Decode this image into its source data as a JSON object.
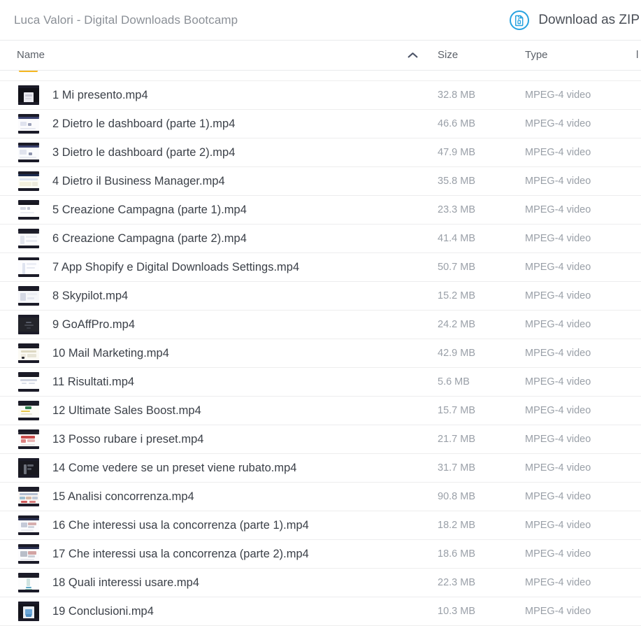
{
  "header": {
    "folder_title": "Luca Valori - Digital Downloads Bootcamp",
    "download_zip_label": "Download as ZIP",
    "download_zip_icon": "zip-file-circle-icon",
    "accent_color": "#29a3e0"
  },
  "columns": {
    "name": "Name",
    "size": "Size",
    "type": "Type",
    "extra_cut_off": "l",
    "sort_icon": "chevron-up-icon",
    "sort_direction": "ascending",
    "sorted_by": "Name"
  },
  "files": [
    {
      "name": "1 Mi presento.mp4",
      "size": "32.8 MB",
      "type": "MPEG-4 video",
      "thumb": {
        "bg": "#111118",
        "flecks": [
          [
            8,
            6,
            14,
            16,
            "#e9e9ef"
          ],
          [
            10,
            9,
            10,
            3,
            "#c9c9d6"
          ],
          [
            10,
            14,
            9,
            2,
            "#d6d6e0"
          ]
        ]
      }
    },
    {
      "name": "2 Dietro le dashboard (parte 1).mp4",
      "size": "46.6 MB",
      "type": "MPEG-4 video",
      "thumb": {
        "bg": "#fbfbfd",
        "flecks": [
          [
            0,
            0,
            30,
            3,
            "#3c4370"
          ],
          [
            3,
            7,
            9,
            6,
            "#dfe2ee"
          ],
          [
            14,
            9,
            5,
            4,
            "#9aa0b8"
          ],
          [
            3,
            16,
            22,
            2,
            "#e6e8f0"
          ]
        ]
      }
    },
    {
      "name": "3 Dietro le dashboard (parte 2).mp4",
      "size": "47.9 MB",
      "type": "MPEG-4 video",
      "thumb": {
        "bg": "#fafbfd",
        "flecks": [
          [
            0,
            0,
            30,
            3,
            "#3c4370"
          ],
          [
            2,
            6,
            10,
            7,
            "#e1e4ee"
          ],
          [
            15,
            10,
            5,
            4,
            "#8d93ad"
          ],
          [
            2,
            16,
            24,
            2,
            "#e8eaf1"
          ]
        ]
      }
    },
    {
      "name": "4 Dietro il Business Manager.mp4",
      "size": "35.8 MB",
      "type": "MPEG-4 video",
      "thumb": {
        "bg": "#fdfdf6",
        "flecks": [
          [
            0,
            0,
            30,
            3,
            "#1b2a4e"
          ],
          [
            2,
            6,
            26,
            3,
            "#dfe6f2"
          ],
          [
            2,
            11,
            17,
            6,
            "#f3f0de"
          ],
          [
            20,
            11,
            8,
            6,
            "#eceadd"
          ]
        ]
      }
    },
    {
      "name": "5 Creazione Campagna (parte 1).mp4",
      "size": "23.3 MB",
      "type": "MPEG-4 video",
      "thumb": {
        "bg": "#ffffff",
        "flecks": [
          [
            0,
            0,
            30,
            3,
            "#16161e"
          ],
          [
            3,
            6,
            8,
            4,
            "#d7dae4"
          ],
          [
            13,
            6,
            4,
            4,
            "#c4c8d4"
          ],
          [
            3,
            13,
            20,
            2,
            "#eceef3"
          ]
        ]
      }
    },
    {
      "name": "6 Creazione Campagna (parte 2).mp4",
      "size": "41.4 MB",
      "type": "MPEG-4 video",
      "thumb": {
        "bg": "#fcfcfe",
        "flecks": [
          [
            0,
            0,
            30,
            3,
            "#21212c"
          ],
          [
            3,
            6,
            6,
            12,
            "#e2e5ee"
          ],
          [
            11,
            6,
            16,
            3,
            "#eef0f5"
          ],
          [
            11,
            12,
            16,
            3,
            "#e8eaf2"
          ]
        ]
      }
    },
    {
      "name": "7 App Shopify e Digital Downloads Settings.mp4",
      "size": "50.7 MB",
      "type": "MPEG-4 video",
      "thumb": {
        "bg": "#fdfdff",
        "flecks": [
          [
            6,
            4,
            4,
            16,
            "#dfe4f0"
          ],
          [
            12,
            4,
            14,
            3,
            "#eceef6"
          ],
          [
            12,
            10,
            12,
            2,
            "#e6e9f2"
          ]
        ]
      }
    },
    {
      "name": "8 Skypilot.mp4",
      "size": "15.2 MB",
      "type": "MPEG-4 video",
      "thumb": {
        "bg": "#f6f7fa",
        "flecks": [
          [
            0,
            0,
            30,
            3,
            "#1e1e28"
          ],
          [
            3,
            6,
            8,
            11,
            "#d4d8e4"
          ],
          [
            13,
            6,
            14,
            3,
            "#eceef4"
          ],
          [
            13,
            12,
            10,
            3,
            "#e4e7f0"
          ]
        ]
      }
    },
    {
      "name": "9 GoAffPro.mp4",
      "size": "24.2 MB",
      "type": "MPEG-4 video",
      "thumb": {
        "bg": "#23242a",
        "flecks": [
          [
            11,
            6,
            8,
            2,
            "#565a66"
          ],
          [
            9,
            10,
            13,
            2,
            "#44474f"
          ],
          [
            12,
            14,
            6,
            2,
            "#3a3d46"
          ]
        ]
      }
    },
    {
      "name": "10 Mail Marketing.mp4",
      "size": "42.9 MB",
      "type": "MPEG-4 video",
      "thumb": {
        "bg": "#fbfaf4",
        "flecks": [
          [
            0,
            0,
            30,
            3,
            "#1a1a24"
          ],
          [
            4,
            6,
            22,
            3,
            "#ded9c3"
          ],
          [
            4,
            11,
            7,
            6,
            "#f0ece0"
          ],
          [
            13,
            11,
            13,
            5,
            "#e7e4d6"
          ],
          [
            5,
            15,
            4,
            3,
            "#2b2b33"
          ]
        ]
      }
    },
    {
      "name": "11 Risultati.mp4",
      "size": "5.6 MB",
      "type": "MPEG-4 video",
      "thumb": {
        "bg": "#ffffff",
        "flecks": [
          [
            0,
            0,
            30,
            3,
            "#191923"
          ],
          [
            3,
            6,
            24,
            3,
            "#cfd4e0"
          ],
          [
            5,
            11,
            7,
            2,
            "#dadee8"
          ],
          [
            15,
            11,
            9,
            2,
            "#dadee8"
          ]
        ]
      }
    },
    {
      "name": "12 Ultimate Sales Boost.mp4",
      "size": "15.7 MB",
      "type": "MPEG-4 video",
      "thumb": {
        "bg": "#fdfcf7",
        "flecks": [
          [
            0,
            0,
            30,
            3,
            "#1c1c26"
          ],
          [
            10,
            4,
            9,
            4,
            "#2f7d4e"
          ],
          [
            4,
            10,
            13,
            2,
            "#e8c84a"
          ],
          [
            4,
            14,
            16,
            2,
            "#e6e3d6"
          ]
        ]
      }
    },
    {
      "name": "13 Posso rubare i preset.mp4",
      "size": "21.7 MB",
      "type": "MPEG-4 video",
      "thumb": {
        "bg": "#fdfbfb",
        "flecks": [
          [
            0,
            0,
            30,
            3,
            "#22222c"
          ],
          [
            4,
            5,
            20,
            4,
            "#c74b4b"
          ],
          [
            4,
            10,
            7,
            5,
            "#dd8383"
          ],
          [
            13,
            10,
            11,
            4,
            "#e8b4b4"
          ],
          [
            4,
            17,
            20,
            2,
            "#e9e6e6"
          ]
        ]
      }
    },
    {
      "name": "14 Come vedere se un preset viene rubato.mp4",
      "size": "31.7 MB",
      "type": "MPEG-4 video",
      "thumb": {
        "bg": "#191920",
        "flecks": [
          [
            8,
            5,
            4,
            14,
            "#6e727c"
          ],
          [
            13,
            5,
            9,
            3,
            "#5b5f69"
          ],
          [
            13,
            10,
            6,
            3,
            "#4c505a"
          ]
        ]
      }
    },
    {
      "name": "15 Analisi concorrenza.mp4",
      "size": "90.8 MB",
      "type": "MPEG-4 video",
      "thumb": {
        "bg": "#fbf7f4",
        "flecks": [
          [
            0,
            0,
            30,
            3,
            "#23232e"
          ],
          [
            2,
            5,
            26,
            3,
            "#b5c0d2"
          ],
          [
            2,
            10,
            8,
            4,
            "#9fbfd0"
          ],
          [
            11,
            10,
            8,
            4,
            "#d8b9a6"
          ],
          [
            20,
            10,
            8,
            4,
            "#c0cad8"
          ],
          [
            4,
            16,
            9,
            3,
            "#cf5a5a"
          ],
          [
            16,
            16,
            9,
            3,
            "#d77b7b"
          ]
        ]
      }
    },
    {
      "name": "16 Che interessi usa la concorrenza (parte 1).mp4",
      "size": "18.2 MB",
      "type": "MPEG-4 video",
      "thumb": {
        "bg": "#fcfcfe",
        "flecks": [
          [
            0,
            0,
            30,
            3,
            "#2a3050"
          ],
          [
            4,
            6,
            9,
            7,
            "#c5cad8"
          ],
          [
            14,
            6,
            12,
            4,
            "#d6aeae"
          ],
          [
            14,
            11,
            9,
            3,
            "#cfd4de"
          ],
          [
            4,
            16,
            18,
            2,
            "#e9ebf1"
          ]
        ]
      }
    },
    {
      "name": "17 Che interessi usa la concorrenza (parte 2).mp4",
      "size": "18.6 MB",
      "type": "MPEG-4 video",
      "thumb": {
        "bg": "#fbfbfd",
        "flecks": [
          [
            0,
            0,
            30,
            3,
            "#2a3050"
          ],
          [
            3,
            6,
            10,
            8,
            "#b9bec9"
          ],
          [
            14,
            6,
            12,
            5,
            "#d2a3a3"
          ],
          [
            14,
            12,
            10,
            3,
            "#c9ced8"
          ],
          [
            3,
            17,
            20,
            2,
            "#e7e9ef"
          ]
        ]
      }
    },
    {
      "name": "18 Quali interessi usare.mp4",
      "size": "22.3 MB",
      "type": "MPEG-4 video",
      "thumb": {
        "bg": "#fcfdfd",
        "flecks": [
          [
            0,
            0,
            30,
            3,
            "#1d1d27"
          ],
          [
            12,
            4,
            5,
            11,
            "#cfe3e0"
          ],
          [
            11,
            16,
            8,
            2,
            "#5ea7c8"
          ],
          [
            10,
            19,
            10,
            2,
            "#8fd0bb"
          ]
        ]
      }
    },
    {
      "name": "19 Conclusioni.mp4",
      "size": "10.3 MB",
      "type": "MPEG-4 video",
      "thumb": {
        "bg": "#14141c",
        "flecks": [
          [
            7,
            3,
            16,
            18,
            "#e8edf3"
          ],
          [
            10,
            7,
            10,
            9,
            "#6ea8d8"
          ],
          [
            11,
            14,
            8,
            4,
            "#4f8fc4"
          ]
        ]
      }
    }
  ],
  "partial_row_top": {
    "icon": "folder-icon",
    "icon_color": "#f5b722"
  }
}
